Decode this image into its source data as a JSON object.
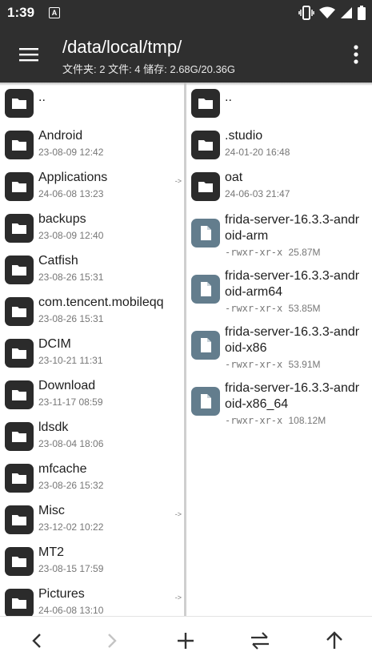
{
  "status_bar": {
    "time": "1:39",
    "notification_letter": "A"
  },
  "app_bar": {
    "path": "/data/local/tmp/",
    "summary": "文件夹: 2  文件: 4  储存: 2.68G/20.36G"
  },
  "left_pane": {
    "items": [
      {
        "name": "..",
        "date": "",
        "arrow": ""
      },
      {
        "name": "Android",
        "date": "23-08-09 12:42",
        "arrow": ""
      },
      {
        "name": "Applications",
        "date": "24-06-08 13:23",
        "arrow": "->"
      },
      {
        "name": "backups",
        "date": "23-08-09 12:40",
        "arrow": ""
      },
      {
        "name": "Catfish",
        "date": "23-08-26 15:31",
        "arrow": ""
      },
      {
        "name": "com.tencent.mobileqq",
        "date": "23-08-26 15:31",
        "arrow": ""
      },
      {
        "name": "DCIM",
        "date": "23-10-21 11:31",
        "arrow": ""
      },
      {
        "name": "Download",
        "date": "23-11-17 08:59",
        "arrow": ""
      },
      {
        "name": "ldsdk",
        "date": "23-08-04 18:06",
        "arrow": ""
      },
      {
        "name": "mfcache",
        "date": "23-08-26 15:32",
        "arrow": ""
      },
      {
        "name": "Misc",
        "date": "23-12-02 10:22",
        "arrow": "->"
      },
      {
        "name": "MT2",
        "date": "23-08-15 17:59",
        "arrow": ""
      },
      {
        "name": "Pictures",
        "date": "24-06-08 13:10",
        "arrow": "->"
      }
    ]
  },
  "right_pane": {
    "folders": [
      {
        "name": "..",
        "date": ""
      },
      {
        "name": ".studio",
        "date": "24-01-20 16:48"
      },
      {
        "name": "oat",
        "date": "24-06-03 21:47"
      }
    ],
    "files": [
      {
        "name_line1": "frida-server-16.3.3-andr",
        "name_line2": "oid-arm",
        "perms": "-rwxr-xr-x",
        "size": "25.87M"
      },
      {
        "name_line1": "frida-server-16.3.3-andr",
        "name_line2": "oid-arm64",
        "perms": "-rwxr-xr-x",
        "size": "53.85M"
      },
      {
        "name_line1": "frida-server-16.3.3-andr",
        "name_line2": "oid-x86",
        "perms": "-rwxr-xr-x",
        "size": "53.91M"
      },
      {
        "name_line1": "frida-server-16.3.3-andr",
        "name_line2": "oid-x86_64",
        "perms": "-rwxr-xr-x",
        "size": "108.12M"
      }
    ]
  },
  "bottom_bar": {
    "buttons": [
      {
        "icon": "back-arrow-icon",
        "enabled": true
      },
      {
        "icon": "forward-arrow-icon",
        "enabled": false
      },
      {
        "icon": "add-icon",
        "enabled": true
      },
      {
        "icon": "swap-icon",
        "enabled": true
      },
      {
        "icon": "up-arrow-icon",
        "enabled": true
      }
    ]
  },
  "colors": {
    "bar_background": "#2f2f2f",
    "folder_icon": "#2b2b2b",
    "file_icon": "#637d8d",
    "divider": "#cfcfcf"
  }
}
